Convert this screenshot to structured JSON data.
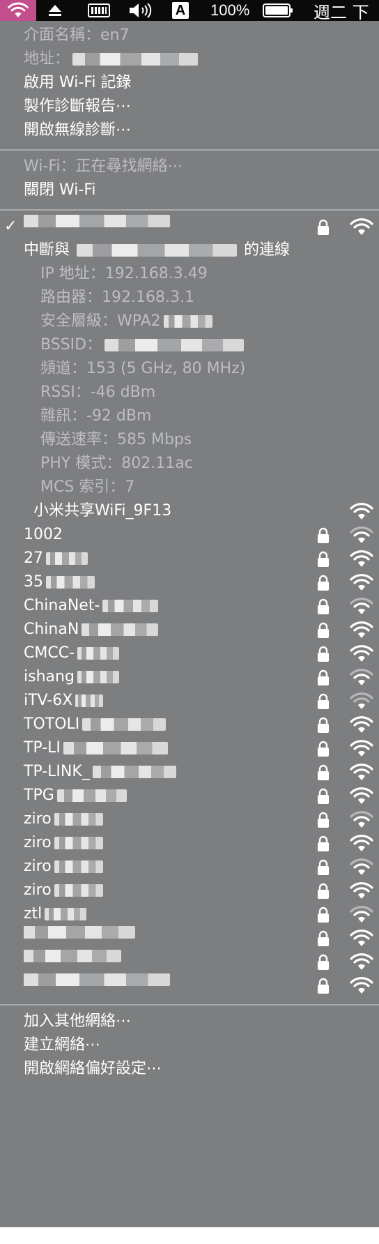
{
  "menubar": {
    "battery_percent": "100%",
    "clock": "週二 下",
    "input_source": "A"
  },
  "menu": {
    "info": {
      "interface_name": "介面名稱：en7",
      "address_label": "地址："
    },
    "actions": {
      "enable_wifi_log": "啟用 Wi-Fi 記錄",
      "create_diagnostics_report": "製作診斷報告⋯",
      "open_wireless_diagnostics": "開啟無線診斷⋯"
    },
    "wifi": {
      "status": "Wi-Fi：正在尋找網絡⋯",
      "turn_off": "關閉 Wi-Fi"
    },
    "current_network": {
      "disconnect_prefix": "中斷與",
      "disconnect_suffix": "的連線",
      "ip": "IP 地址：192.168.3.49",
      "router": "路由器：192.168.3.1",
      "security_prefix": "安全層級：WPA2",
      "bssid_label": "BSSID：",
      "channel": "頻道：153 (5 GHz, 80 MHz)",
      "rssi": "RSSI：-46 dBm",
      "noise": "雜訊：-92 dBm",
      "tx_rate": "傳送速率：585 Mbps",
      "phy_mode": "PHY 模式：802.11ac",
      "mcs_index": "MCS 索引：7"
    },
    "networks": [
      {
        "name": "小米共享WiFi_9F13",
        "locked": false,
        "strength": 1.0
      },
      {
        "name": "1002",
        "locked": true,
        "strength": 0.75
      },
      {
        "name": "27",
        "locked": true,
        "strength": 1.0
      },
      {
        "name": "35",
        "locked": true,
        "strength": 1.0
      },
      {
        "name": "ChinaNet-",
        "locked": true,
        "strength": 0.75
      },
      {
        "name": "ChinaN",
        "locked": true,
        "strength": 1.0
      },
      {
        "name": "CMCC-",
        "locked": true,
        "strength": 1.0
      },
      {
        "name": "ishang",
        "locked": true,
        "strength": 0.75
      },
      {
        "name": "iTV-6X",
        "locked": true,
        "strength": 0.5
      },
      {
        "name": "TOTOLI",
        "locked": true,
        "strength": 1.0
      },
      {
        "name": "TP-LI",
        "locked": true,
        "strength": 1.0
      },
      {
        "name": "TP-LINK_",
        "locked": true,
        "strength": 1.0
      },
      {
        "name": "TPG",
        "locked": true,
        "strength": 1.0
      },
      {
        "name": "ziro",
        "locked": true,
        "strength": 0.75
      },
      {
        "name": "ziro",
        "locked": true,
        "strength": 1.0
      },
      {
        "name": "ziro",
        "locked": true,
        "strength": 0.75
      },
      {
        "name": "ziro",
        "locked": true,
        "strength": 1.0
      },
      {
        "name": "ztl",
        "locked": true,
        "strength": 0.75
      },
      {
        "name": "",
        "locked": true,
        "strength": 1.0
      },
      {
        "name": "",
        "locked": true,
        "strength": 1.0
      },
      {
        "name": "",
        "locked": true,
        "strength": 1.0
      }
    ],
    "footer": {
      "join_other": "加入其他網絡⋯",
      "create_network": "建立網絡⋯",
      "open_network_prefs": "開啟網絡偏好設定⋯"
    }
  }
}
